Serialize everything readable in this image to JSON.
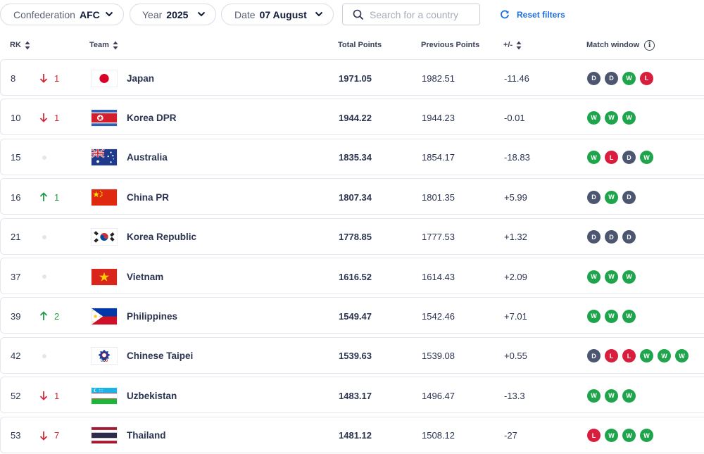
{
  "filters": {
    "confederation_label": "Confederation",
    "confederation_value": "AFC",
    "year_label": "Year",
    "year_value": "2025",
    "date_label": "Date",
    "date_value": "07 August",
    "search_placeholder": "Search for a country",
    "reset_label": "Reset filters"
  },
  "columns": {
    "rank": "RK",
    "team": "Team",
    "total": "Total Points",
    "previous": "Previous Points",
    "diff": "+/-",
    "window": "Match window"
  },
  "colors": {
    "win": "#1ea54c",
    "draw": "#4c5670",
    "loss": "#d81e3c",
    "up": "#1f9a45",
    "down": "#d0283a",
    "accent": "#1e6fe0"
  },
  "rows": [
    {
      "rank": "8",
      "move_dir": "down",
      "move": "1",
      "flag": "japan",
      "team": "Japan",
      "total": "1971.05",
      "previous": "1982.51",
      "diff": "-11.46",
      "results": [
        "D",
        "D",
        "W",
        "L"
      ]
    },
    {
      "rank": "10",
      "move_dir": "down",
      "move": "1",
      "flag": "korea-dpr",
      "team": "Korea DPR",
      "total": "1944.22",
      "previous": "1944.23",
      "diff": "-0.01",
      "results": [
        "W",
        "W",
        "W"
      ]
    },
    {
      "rank": "15",
      "move_dir": "none",
      "move": "",
      "flag": "australia",
      "team": "Australia",
      "total": "1835.34",
      "previous": "1854.17",
      "diff": "-18.83",
      "results": [
        "W",
        "L",
        "D",
        "W"
      ]
    },
    {
      "rank": "16",
      "move_dir": "up",
      "move": "1",
      "flag": "china",
      "team": "China PR",
      "total": "1807.34",
      "previous": "1801.35",
      "diff": "+5.99",
      "results": [
        "D",
        "W",
        "D"
      ]
    },
    {
      "rank": "21",
      "move_dir": "none",
      "move": "",
      "flag": "korea-rep",
      "team": "Korea Republic",
      "total": "1778.85",
      "previous": "1777.53",
      "diff": "+1.32",
      "results": [
        "D",
        "D",
        "D"
      ]
    },
    {
      "rank": "37",
      "move_dir": "none",
      "move": "",
      "flag": "vietnam",
      "team": "Vietnam",
      "total": "1616.52",
      "previous": "1614.43",
      "diff": "+2.09",
      "results": [
        "W",
        "W",
        "W"
      ]
    },
    {
      "rank": "39",
      "move_dir": "up",
      "move": "2",
      "flag": "philippines",
      "team": "Philippines",
      "total": "1549.47",
      "previous": "1542.46",
      "diff": "+7.01",
      "results": [
        "W",
        "W",
        "W"
      ]
    },
    {
      "rank": "42",
      "move_dir": "none",
      "move": "",
      "flag": "chinese-taipei",
      "team": "Chinese Taipei",
      "total": "1539.63",
      "previous": "1539.08",
      "diff": "+0.55",
      "results": [
        "D",
        "L",
        "L",
        "W",
        "W",
        "W"
      ]
    },
    {
      "rank": "52",
      "move_dir": "down",
      "move": "1",
      "flag": "uzbekistan",
      "team": "Uzbekistan",
      "total": "1483.17",
      "previous": "1496.47",
      "diff": "-13.3",
      "results": [
        "W",
        "W",
        "W"
      ]
    },
    {
      "rank": "53",
      "move_dir": "down",
      "move": "7",
      "flag": "thailand",
      "team": "Thailand",
      "total": "1481.12",
      "previous": "1508.12",
      "diff": "-27",
      "results": [
        "L",
        "W",
        "W",
        "W"
      ]
    }
  ]
}
